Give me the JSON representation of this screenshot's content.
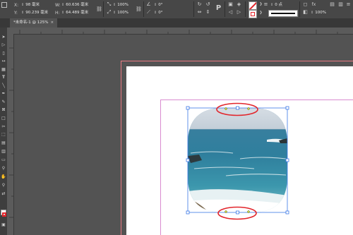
{
  "control_bar": {
    "x_label": "X:",
    "x_value": "98 毫米",
    "y_label": "Y:",
    "y_value": "90.239 毫米",
    "w_label": "W:",
    "w_value": "60.636 毫米",
    "h_label": "H:",
    "h_value": "64.489 毫米",
    "scale_x": "100%",
    "scale_y": "100%",
    "rotate": "0°",
    "shear": "0°",
    "stroke_weight": "0 点",
    "opacity": "100%"
  },
  "document_tab": {
    "title": "*未命名-1 @ 125%",
    "close": "×"
  },
  "tools": [
    "selection",
    "direct-selection",
    "page",
    "gap",
    "type",
    "line",
    "pen",
    "pencil",
    "rectangle-frame",
    "rectangle",
    "scissors",
    "free-transform",
    "gradient",
    "note",
    "eyedropper",
    "hand",
    "zoom",
    "fill-stroke"
  ],
  "colors": {
    "ui_dark": "#474747",
    "canvas": "#535353",
    "bleed": "#e87a82",
    "margin": "#d98cd0",
    "selection": "#3b78e7",
    "highlight_ellipse": "#e2252b",
    "live_corner": "#c9d24a"
  }
}
